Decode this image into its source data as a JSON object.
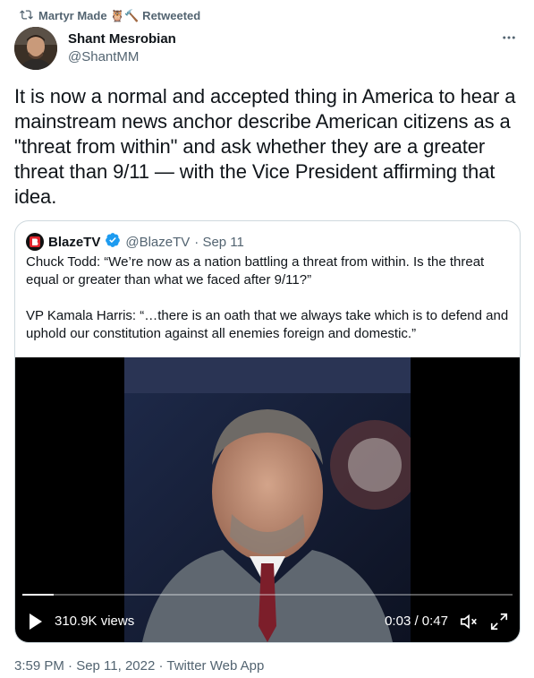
{
  "retweet": {
    "text": "Martyr Made 🦉🔨 Retweeted"
  },
  "author": {
    "name": "Shant Mesrobian",
    "handle": "@ShantMM"
  },
  "tweet": {
    "text": "It is now a normal and accepted thing in America to hear a mainstream news anchor describe American citizens as a \"threat from within\" and ask whether they are a greater threat than 9/11 — with the Vice President affirming that idea."
  },
  "quote": {
    "name": "BlazeTV",
    "handle": "@BlazeTV",
    "date": "· Sep 11",
    "text": "Chuck Todd: “We’re now as a nation battling a threat from within. Is the threat equal or greater than what we faced after 9/11?”\n\nVP Kamala Harris: “…there is an oath that we always take which is to defend and uphold our constitution against all enemies foreign and domestic.”",
    "verified_color": "#1d9bf0"
  },
  "video": {
    "views": "310.9K views",
    "time": "0:03 / 0:47",
    "progress": 0.064
  },
  "meta": {
    "timestamp": "3:59 PM · Sep 11, 2022 · Twitter Web App"
  }
}
